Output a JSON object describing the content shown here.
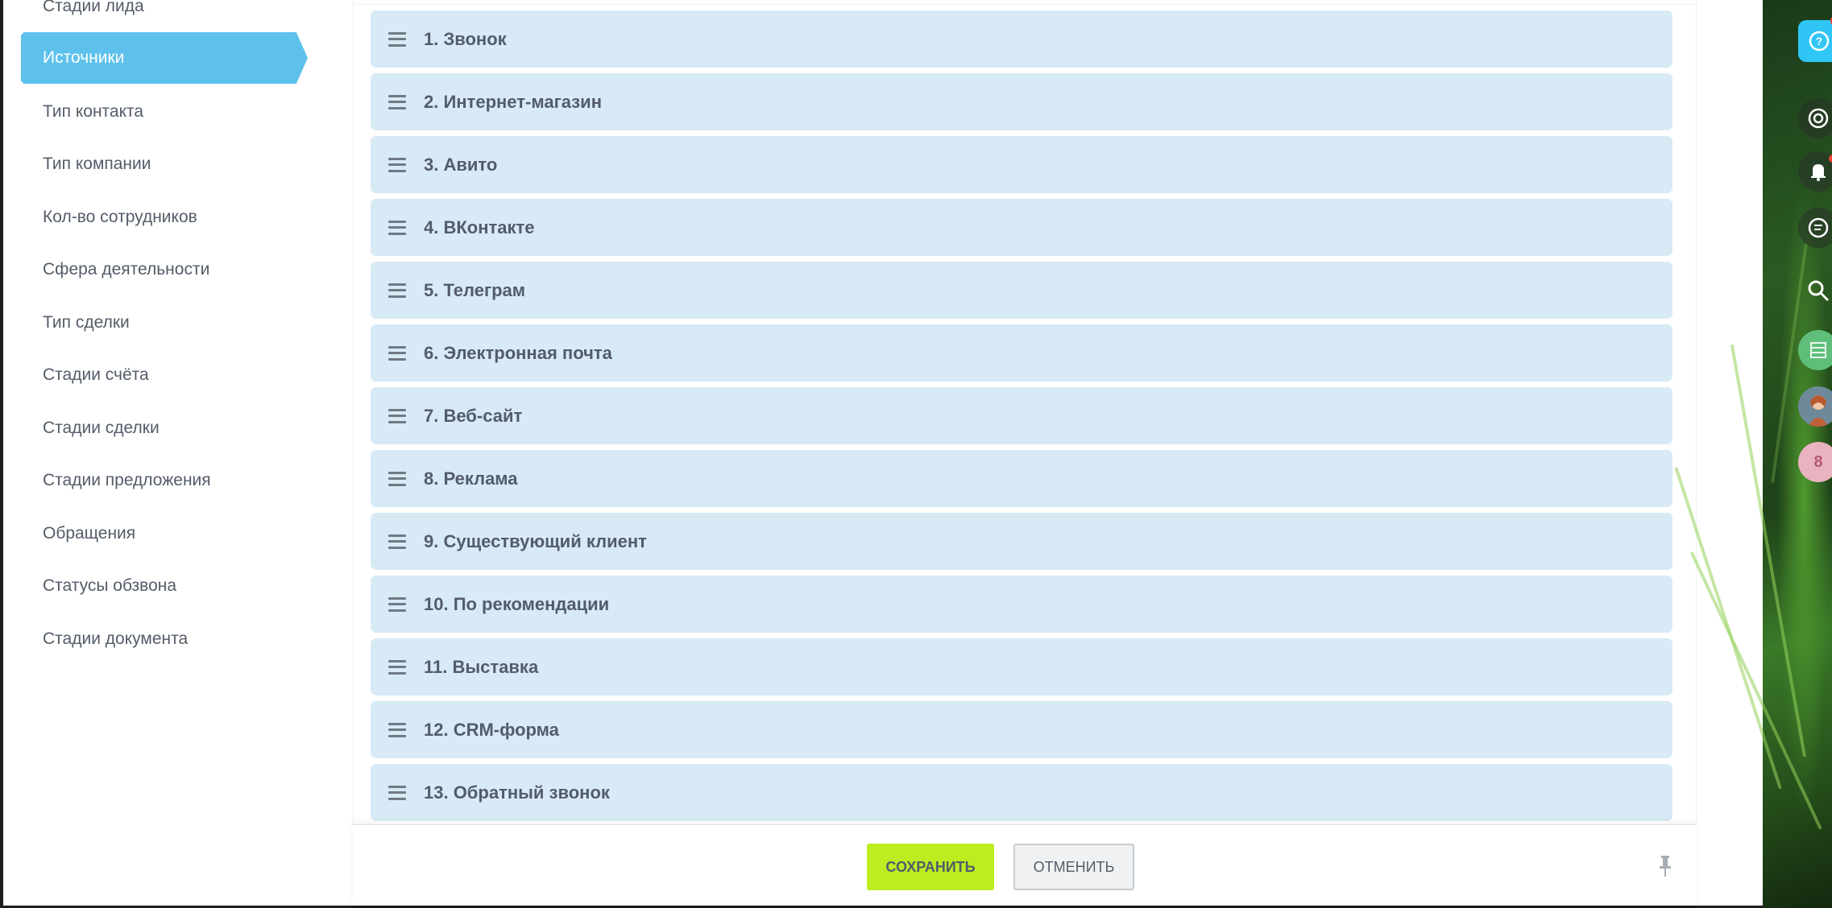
{
  "sidebar": {
    "items": [
      {
        "label": "Стадии лида",
        "active": false
      },
      {
        "label": "Источники",
        "active": true
      },
      {
        "label": "Тип контакта",
        "active": false
      },
      {
        "label": "Тип компании",
        "active": false
      },
      {
        "label": "Кол-во сотрудников",
        "active": false
      },
      {
        "label": "Сфера деятельности",
        "active": false
      },
      {
        "label": "Тип сделки",
        "active": false
      },
      {
        "label": "Стадии счёта",
        "active": false
      },
      {
        "label": "Стадии сделки",
        "active": false
      },
      {
        "label": "Стадии предложения",
        "active": false
      },
      {
        "label": "Обращения",
        "active": false
      },
      {
        "label": "Статусы обзвона",
        "active": false
      },
      {
        "label": "Стадии документа",
        "active": false
      }
    ]
  },
  "sources": [
    "1. Звонок",
    "2. Интернет-магазин",
    "3. Авито",
    "4. ВКонтакте",
    "5. Телеграм",
    "6. Электронная почта",
    "7. Веб-сайт",
    "8. Реклама",
    "9. Существующий клиент",
    "10. По рекомендации",
    "11. Выставка",
    "12. CRM-форма",
    "13. Обратный звонок"
  ],
  "footer": {
    "save_label": "СОХРАНИТЬ",
    "cancel_label": "ОТМЕНИТЬ"
  },
  "right_panel": {
    "help_icon": "question-icon",
    "icons": [
      "target-icon",
      "bell-icon",
      "chat-icon",
      "search-icon",
      "sheet-icon",
      "user-avatar",
      "counter-avatar"
    ],
    "counter_label": "8"
  },
  "colors": {
    "active_nav": "#5ec1ec",
    "row_bg": "#d8eaf6",
    "save_button": "#bbed21",
    "help_button": "#2fc6f6"
  }
}
